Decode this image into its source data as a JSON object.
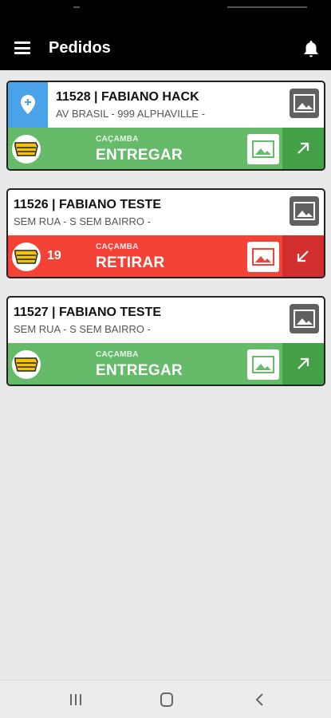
{
  "app": {
    "title": "Pedidos"
  },
  "colors": {
    "header": "#000000",
    "background": "#e9e9e9",
    "pin": "#4aa2e9",
    "entregar": "#66bb6a",
    "entregar_dark": "#43a047",
    "retirar": "#f44336",
    "retirar_dark": "#d32f2f"
  },
  "orders": [
    {
      "title": "11528 | FABIANO HACK",
      "address": "AV BRASIL - 999 ALPHAVILLE -",
      "category": "CAÇAMBA",
      "action": "ENTREGAR",
      "count": "",
      "status": "entregar",
      "pin_icon": "add-location-icon",
      "arrow_icon": "arrow-up-right-icon"
    },
    {
      "title": "11526 | FABIANO TESTE",
      "address": "SEM RUA - S SEM BAIRRO -",
      "category": "CAÇAMBA",
      "action": "RETIRAR",
      "count": "19",
      "status": "retirar",
      "arrow_icon": "arrow-down-left-icon"
    },
    {
      "title": "11527 | FABIANO TESTE",
      "address": "SEM RUA - S SEM BAIRRO -",
      "category": "CAÇAMBA",
      "action": "ENTREGAR",
      "count": "",
      "status": "entregar",
      "arrow_icon": "arrow-up-right-icon"
    }
  ],
  "icons": {
    "menu": "menu-icon",
    "bell": "bell-icon",
    "photo": "image-icon",
    "truck": "dumpster-truck-icon"
  },
  "navbar": {
    "recent": "recent-apps-icon",
    "home": "home-icon",
    "back": "back-icon"
  }
}
